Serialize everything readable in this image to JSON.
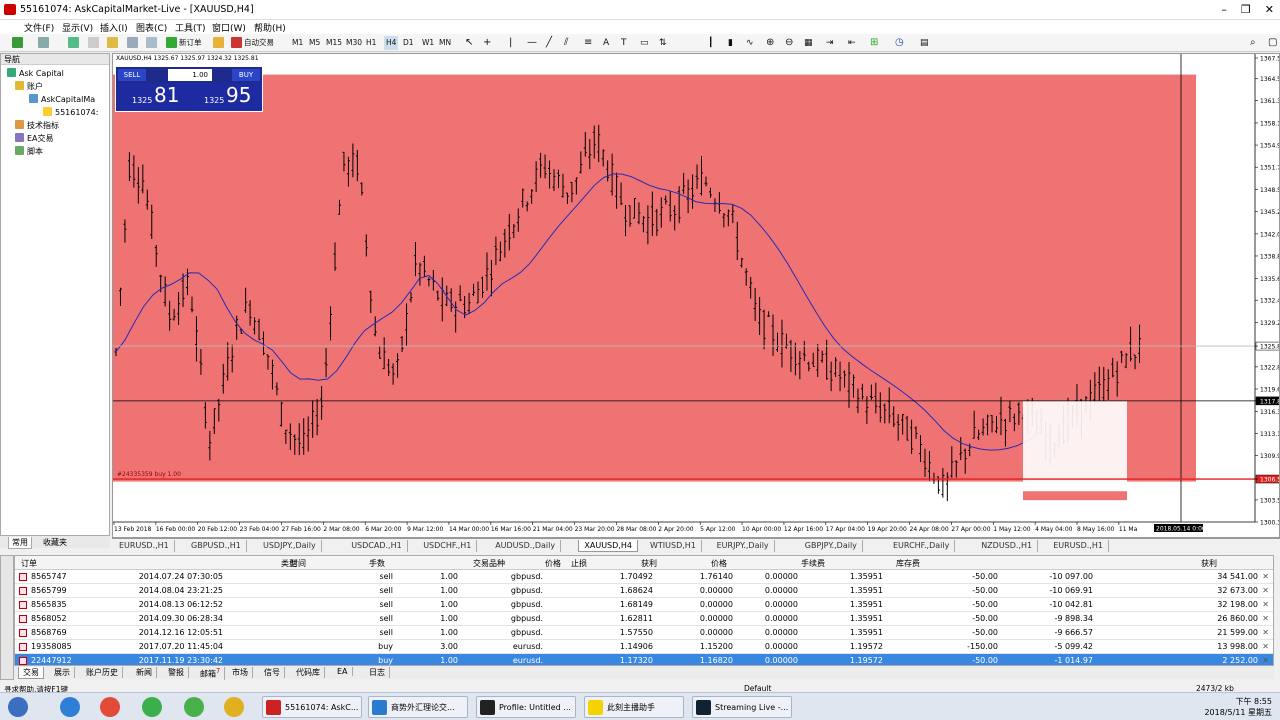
{
  "window": {
    "title": "55161074: AskCapitalMarket-Live - [XAUUSD,H4]"
  },
  "menu": [
    "文件(F)",
    "显示(V)",
    "插入(I)",
    "图表(C)",
    "工具(T)",
    "窗口(W)",
    "帮助(H)"
  ],
  "toolbar": {
    "new_order": "新订单",
    "auto_trading": "自动交易",
    "timeframes": [
      "M1",
      "M5",
      "M15",
      "M30",
      "H1",
      "H4",
      "D1",
      "W1",
      "MN"
    ]
  },
  "navigator": {
    "header": "导航",
    "root": "Ask Capital",
    "accounts": "账户",
    "server": "AskCapitalMa",
    "account": "55161074:",
    "indicators": "技术指标",
    "experts": "EA交易",
    "scripts": "脚本",
    "tabs": [
      "常用",
      "收藏夹"
    ]
  },
  "chart": {
    "symbol_info": "XAUUSD,H4  1325.67 1325.97 1324.32 1325.81",
    "sell_label": "SELL",
    "buy_label": "BUY",
    "lot": "1.00",
    "bid_small": "1325",
    "bid_big": "81",
    "ask_small": "1325",
    "ask_big": "95",
    "order_line_label": "#24335359 buy 1.00",
    "price_labels": [
      "1367.50",
      "1364.50",
      "1361.35",
      "1358.10",
      "1354.90",
      "1351.70",
      "1348.50",
      "1345.25",
      "1342.05",
      "1338.85",
      "1335.60",
      "1332.45",
      "1329.20",
      "1325.81",
      "1322.80",
      "1319.60",
      "1317.88",
      "1316.35",
      "1313.15",
      "1309.95",
      "1306.57",
      "1303.55",
      "1300.35"
    ],
    "current_price": "1325.81",
    "crosshair_price": "1317.88",
    "order_price": "1306.57",
    "date_labels": [
      "13 Feb 2018",
      "16 Feb 00:00",
      "20 Feb 12:00",
      "23 Feb 04:00",
      "27 Feb 16:00",
      "2 Mar 08:00",
      "6 Mar 20:00",
      "9 Mar 12:00",
      "14 Mar 00:00",
      "16 Mar 16:00",
      "21 Mar 04:00",
      "23 Mar 20:00",
      "28 Mar 08:00",
      "2 Apr 20:00",
      "5 Apr 12:00",
      "10 Apr 00:00",
      "12 Apr 16:00",
      "17 Apr 04:00",
      "19 Apr 20:00",
      "24 Apr 08:00",
      "27 Apr 00:00",
      "1 May 12:00",
      "4 May 04:00",
      "8 May 16:00",
      "11 Ma"
    ],
    "crosshair_date": "2018.05.14 0:00",
    "colors": {
      "zone": "#ef7372",
      "bull": "#000000",
      "bear": "#000000",
      "ma": "#2a2ab8",
      "order_line": "#e02020",
      "box": "#ffffff"
    }
  },
  "symbol_tabs": [
    "EURUSD.,H1",
    "GBPUSD.,H1",
    "USDJPY.,Daily",
    "USDCAD.,H1",
    "USDCHF.,H1",
    "AUDUSD.,Daily",
    "XAUUSD,H4",
    "WTIUSD,H1",
    "EURJPY.,Daily",
    "GBPJPY.,Daily",
    "EURCHF.,Daily",
    "NZDUSD.,H1",
    "EURUSD.,H1"
  ],
  "terminal": {
    "headers": [
      "订单",
      "时间",
      "类型",
      "手数",
      "交易品种",
      "价格",
      "止损",
      "获利",
      "价格",
      "手续费",
      "库存费",
      "获利"
    ],
    "rows": [
      [
        "8565747",
        "2014.07.24 07:30:05",
        "sell",
        "1.00",
        "gbpusd.",
        "1.70492",
        "1.76140",
        "0.00000",
        "1.35951",
        "-50.00",
        "-10 097.00",
        "34 541.00"
      ],
      [
        "8565799",
        "2014.08.04 23:21:25",
        "sell",
        "1.00",
        "gbpusd.",
        "1.68624",
        "0.00000",
        "0.00000",
        "1.35951",
        "-50.00",
        "-10 069.91",
        "32 673.00"
      ],
      [
        "8565835",
        "2014.08.13 06:12:52",
        "sell",
        "1.00",
        "gbpusd.",
        "1.68149",
        "0.00000",
        "0.00000",
        "1.35951",
        "-50.00",
        "-10 042.81",
        "32 198.00"
      ],
      [
        "8568052",
        "2014.09.30 06:28:34",
        "sell",
        "1.00",
        "gbpusd.",
        "1.62811",
        "0.00000",
        "0.00000",
        "1.35951",
        "-50.00",
        "-9 898.34",
        "26 860.00"
      ],
      [
        "8568769",
        "2014.12.16 12:05:51",
        "sell",
        "1.00",
        "gbpusd.",
        "1.57550",
        "0.00000",
        "0.00000",
        "1.35951",
        "-50.00",
        "-9 666.57",
        "21 599.00"
      ],
      [
        "19358085",
        "2017.07.20 11:45:04",
        "buy",
        "3.00",
        "eurusd.",
        "1.14906",
        "1.15200",
        "0.00000",
        "1.19572",
        "-150.00",
        "-5 099.42",
        "13 998.00"
      ],
      [
        "22447912",
        "2017.11.19 23:30:42",
        "buy",
        "1.00",
        "eurusd.",
        "1.17320",
        "1.16820",
        "0.00000",
        "1.19572",
        "-50.00",
        "-1 014.97",
        "2 252.00"
      ]
    ],
    "tabs": [
      "交易",
      "展示",
      "账户历史",
      "新闻",
      "警报",
      "邮箱",
      "市场",
      "信号",
      "代码库",
      "EA",
      "日志"
    ],
    "mail_count": "7"
  },
  "status": {
    "help": "寻求帮助,请按F1键",
    "profile": "Default",
    "traffic": "2473/2 kb"
  },
  "taskbar": {
    "tasks": [
      "55161074: AskC...",
      "商势外汇理论交...",
      "Profile: Untitled ...",
      "此刻主播助手",
      "Streaming Live -..."
    ],
    "time": "下午 8:55",
    "date": "2018/5/11 星期五"
  }
}
